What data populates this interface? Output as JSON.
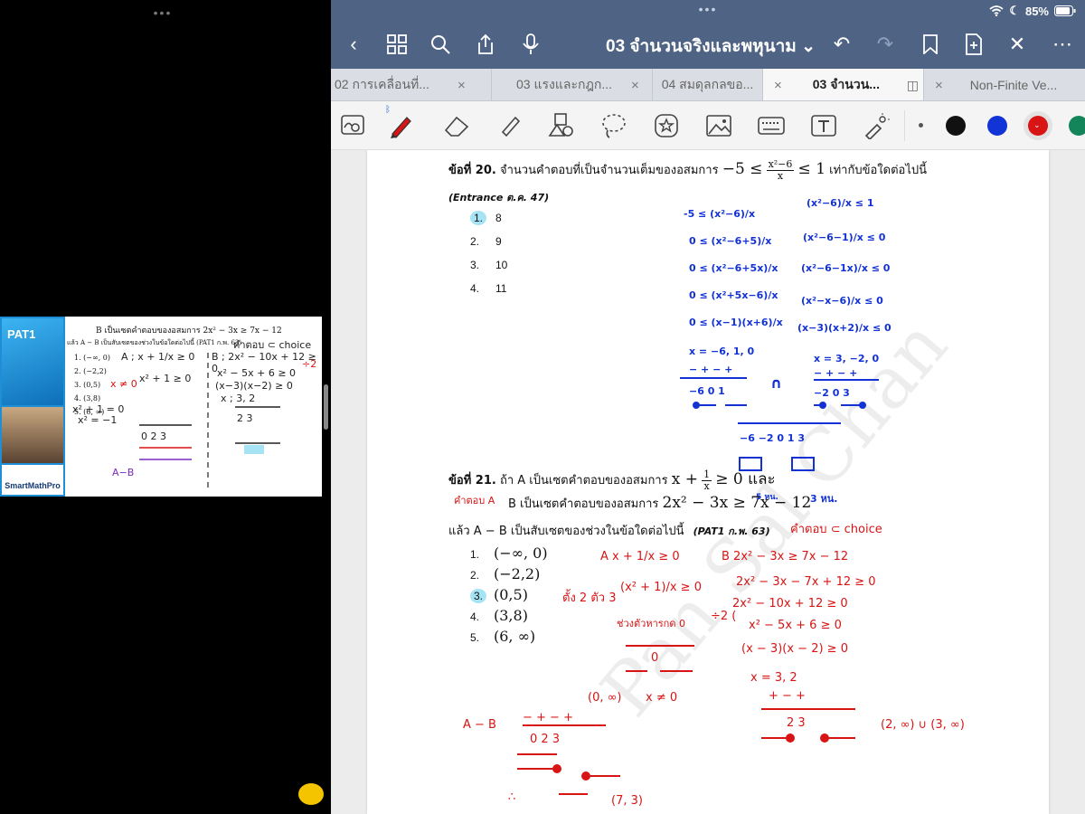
{
  "left_panel": {
    "dots": "•••",
    "video": {
      "cover_title": "PAT1",
      "brand": "SmartMathPro",
      "line_b": "B เป็นเซตคำตอบของอสมการ 2x² − 3x ≥ 7x − 12",
      "line_minus": "แล้ว A − B เป็นสับเซตของช่วงในข้อใดต่อไปนี้ (PAT1 ก.พ. 63)",
      "note_choice": "คำตอบ ⊂ choice",
      "choices": [
        "1. (−∞, 0)",
        "2. (−2,2)",
        "3. (0,5)",
        "4. (3,8)",
        "5. (6, ∞)"
      ],
      "ink_a": "A ; x + 1/x ≥ 0",
      "ink_b": "B ; 2x² − 10x + 12 ≥ 0",
      "ink_b2": "x² − 5x + 6 ≥ 0",
      "ink_b3": "(x−3)(x−2) ≥ 0",
      "ink_b4": "x ; 3, 2",
      "ink_x0": "x ≠ 0",
      "ink_a2": "x² + 1 ≥ 0",
      "ink_div2": "÷2",
      "ink_xsq": "x² + 1 = 0",
      "ink_xsq2": "x² = −1",
      "ink_nums1": "0  2  3",
      "ink_nums2": "2  3",
      "ink_ab": "A−B"
    }
  },
  "status": {
    "dots": "•••",
    "wifi": "wifi-icon",
    "moon": "moon-icon",
    "battery": "85%"
  },
  "toolbar": {
    "title": "03 จำนวนจริงและพหุนาม ⌄"
  },
  "tabs": [
    {
      "label": "02 การเคลื่อนที่...",
      "close": "×"
    },
    {
      "label": "03 แรงและกฎก...",
      "close": "×"
    },
    {
      "label": "04 สมดุลกลขอ...",
      "close": "×"
    },
    {
      "label": "03 จำนวน...",
      "close": "×"
    },
    {
      "label": "Non-Finite Ve...",
      "close": ""
    }
  ],
  "pen_colors": {
    "black": "#111111",
    "blue": "#1233d6",
    "red": "#d81414",
    "green": "#14855a"
  },
  "page": {
    "q20": {
      "label": "ข้อที่ 20.",
      "text": "จำนวนคำตอบที่เป็นจำนวนเต็มของอสมการ",
      "ineq_left": "−5 ≤",
      "frac_num": "x²−6",
      "frac_den": "x",
      "ineq_right": "≤ 1",
      "tail": "เท่ากับข้อใดต่อไปนี้",
      "source": "(Entrance ต.ค. 47)",
      "choices": [
        {
          "n": "1.",
          "v": "8"
        },
        {
          "n": "2.",
          "v": "9"
        },
        {
          "n": "3.",
          "v": "10"
        },
        {
          "n": "4.",
          "v": "11"
        }
      ]
    },
    "q20_ink_left": [
      "-5 ≤ (x²−6)/x",
      "0 ≤ (x²−6+5)/x",
      "0 ≤ (x²−6+5x)/x",
      "0 ≤ (x²+5x−6)/x",
      "0 ≤ (x−1)(x+6)/x",
      "x = −6, 1, 0",
      "−  +  −  +",
      "−6  0  1",
      "∩"
    ],
    "q20_ink_right": [
      "(x²−6)/x ≤ 1",
      "(x²−6−1)/x ≤ 0",
      "(x²−6−1x)/x ≤ 0",
      "(x²−x−6)/x ≤ 0",
      "(x−3)(x+2)/x ≤ 0",
      "x = 3, −2, 0",
      "−  +  −  +",
      "−2  0  3"
    ],
    "q20_ink_bottom": "−6 −2  0  1  3",
    "q21": {
      "label": "ข้อที่ 21.",
      "line1_a": "ถ้า A เป็นเซตคำตอบของอสมการ",
      "line1_expr": "x +",
      "frac_num": "1",
      "frac_den": "x",
      "line1_tail": "≥ 0 และ",
      "line2_a": "B เป็นเซตคำตอบของอสมการ",
      "line2_expr": "2x² − 3x ≥ 7x − 12",
      "line3_a": "แล้ว A − B เป็นสับเซตของช่วงในข้อใดต่อไปนี้",
      "source": "(PAT1 ก.พ. 63)",
      "choices": [
        {
          "n": "1.",
          "v": "(−∞, 0)"
        },
        {
          "n": "2.",
          "v": "(−2,2)"
        },
        {
          "n": "3.",
          "v": "(0,5)"
        },
        {
          "n": "4.",
          "v": "(3,8)"
        },
        {
          "n": "5.",
          "v": "(6, ∞)"
        }
      ]
    },
    "q21_ink": {
      "note_left": "คำตอบ A",
      "note_right": "คำตอบ ⊂ choice",
      "note_3": "3 หน.",
      "note_5": "5 หน.",
      "choice_note": "ตั้ง 2 ตัว 3",
      "a1": "A   x + 1/x ≥ 0",
      "a2": "(x² + 1)/x ≥ 0",
      "a3": "ช่วงตัวหารกด 0",
      "a4": "0",
      "a5": "(0, ∞)",
      "a6": "x ≠ 0",
      "b1": "B  2x² − 3x ≥ 7x − 12",
      "b2": "2x² − 3x − 7x + 12 ≥ 0",
      "b3": "2x² − 10x + 12 ≥ 0",
      "b3_div": "÷2 (",
      "b4": "x² − 5x + 6 ≥ 0",
      "b5": "(x − 3)(x − 2) ≥ 0",
      "b6": "x = 3, 2",
      "b7": "+     −     +",
      "b8": "2       3",
      "b9": "(2, ∞) ∪ (3, ∞)",
      "ab1": "A − B",
      "ab2": "−  +  −  +",
      "ab3": "0   2   3",
      "ab4": "(7, 3)",
      "ab5": "∴"
    },
    "watermark": "Pan Sal Chan"
  }
}
